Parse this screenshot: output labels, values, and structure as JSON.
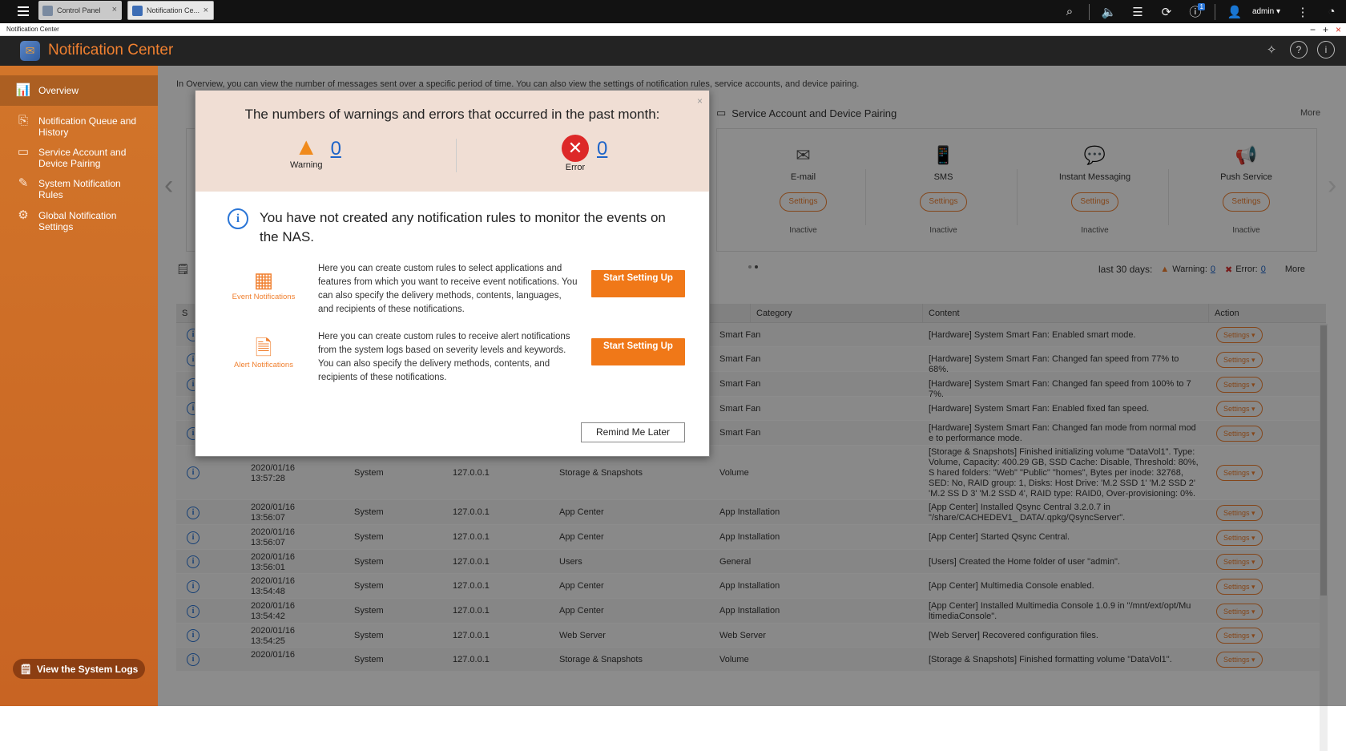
{
  "topbar": {
    "tabs": [
      {
        "label": "Control Panel"
      },
      {
        "label": "Notification Ce..."
      }
    ],
    "user": "admin",
    "notification_badge": "1"
  },
  "window": {
    "title": "Notification Center"
  },
  "app": {
    "title": "Notification Center"
  },
  "sidebar": {
    "items": [
      {
        "label": "Overview",
        "icon": "chart-icon"
      },
      {
        "label": "Notification Queue and History",
        "icon": "history-icon"
      },
      {
        "label": "Service Account and Device Pairing",
        "icon": "device-icon"
      },
      {
        "label": "System Notification Rules",
        "icon": "rules-icon"
      },
      {
        "label": "Global Notification Settings",
        "icon": "settings-icon"
      }
    ],
    "logs_button": "View the System Logs"
  },
  "overview": {
    "intro": "In Overview, you can view the number of messages sent over a specific period of time. You can also view the settings of notification rules, service accounts, and device pairing.",
    "service_section_title": "Service Account and Device Pairing",
    "more": "More",
    "services": [
      {
        "name": "E-mail",
        "button": "Settings",
        "status": "Inactive",
        "icon": "mail-icon"
      },
      {
        "name": "SMS",
        "button": "Settings",
        "status": "Inactive",
        "icon": "sms-icon"
      },
      {
        "name": "Instant Messaging",
        "button": "Settings",
        "status": "Inactive",
        "icon": "chat-icon"
      },
      {
        "name": "Push Service",
        "button": "Settings",
        "status": "Inactive",
        "icon": "megaphone-icon"
      }
    ],
    "stats": {
      "period": "last 30 days:",
      "warning_label": "Warning:",
      "warning_count": "0",
      "error_label": "Error:",
      "error_count": "0",
      "more": "More"
    }
  },
  "table": {
    "columns": [
      "S",
      "",
      "",
      "",
      "",
      "Category",
      "Content",
      "Action"
    ],
    "rows": [
      {
        "date": "",
        "time": "",
        "user": "",
        "ip": "",
        "app": "",
        "category": "Smart Fan",
        "content": "[Hardware] System Smart Fan: Enabled smart mode.",
        "action": "Settings ▾"
      },
      {
        "date": "",
        "time": "",
        "user": "",
        "ip": "",
        "app": "",
        "category": "Smart Fan",
        "content": "[Hardware] System Smart Fan: Changed fan speed from 77% to 68%.",
        "action": "Settings ▾"
      },
      {
        "date": "",
        "time": "",
        "user": "",
        "ip": "",
        "app": "",
        "category": "Smart Fan",
        "content": "[Hardware] System Smart Fan: Changed fan speed from 100% to 7 7%.",
        "action": "Settings ▾"
      },
      {
        "date": "",
        "time": "",
        "user": "",
        "ip": "",
        "app": "",
        "category": "Smart Fan",
        "content": "[Hardware] System Smart Fan: Enabled fixed fan speed.",
        "action": "Settings ▾"
      },
      {
        "date": "",
        "time": "",
        "user": "",
        "ip": "",
        "app": "",
        "category": "Smart Fan",
        "content": "[Hardware] System Smart Fan: Changed fan mode from normal mod e to performance mode.",
        "action": "Settings ▾"
      },
      {
        "date": "2020/01/16",
        "time": "13:57:28",
        "user": "System",
        "ip": "127.0.0.1",
        "app": "Storage & Snapshots",
        "category": "Volume",
        "content": "[Storage & Snapshots] Finished initializing volume \"DataVol1\". Type: Volume, Capacity: 400.29 GB, SSD Cache: Disable, Threshold: 80%, S hared folders: \"Web\" \"Public\" \"homes\", Bytes per inode: 32768, SED: No, RAID group: 1, Disks: Host Drive: 'M.2 SSD 1' 'M.2 SSD 2' 'M.2 SS D 3' 'M.2 SSD 4', RAID type: RAID0, Over-provisioning: 0%.",
        "action": "Settings ▾"
      },
      {
        "date": "2020/01/16",
        "time": "13:56:07",
        "user": "System",
        "ip": "127.0.0.1",
        "app": "App Center",
        "category": "App Installation",
        "content": "[App Center] Installed Qsync Central 3.2.0.7 in \"/share/CACHEDEV1_ DATA/.qpkg/QsyncServer\".",
        "action": "Settings ▾"
      },
      {
        "date": "2020/01/16",
        "time": "13:56:07",
        "user": "System",
        "ip": "127.0.0.1",
        "app": "App Center",
        "category": "App Installation",
        "content": "[App Center] Started Qsync Central.",
        "action": "Settings ▾"
      },
      {
        "date": "2020/01/16",
        "time": "13:56:01",
        "user": "System",
        "ip": "127.0.0.1",
        "app": "Users",
        "category": "General",
        "content": "[Users] Created the Home folder of user \"admin\".",
        "action": "Settings ▾"
      },
      {
        "date": "2020/01/16",
        "time": "13:54:48",
        "user": "System",
        "ip": "127.0.0.1",
        "app": "App Center",
        "category": "App Installation",
        "content": "[App Center] Multimedia Console enabled.",
        "action": "Settings ▾"
      },
      {
        "date": "2020/01/16",
        "time": "13:54:42",
        "user": "System",
        "ip": "127.0.0.1",
        "app": "App Center",
        "category": "App Installation",
        "content": "[App Center] Installed Multimedia Console 1.0.9 in \"/mnt/ext/opt/Mu ltimediaConsole\".",
        "action": "Settings ▾"
      },
      {
        "date": "2020/01/16",
        "time": "13:54:25",
        "user": "System",
        "ip": "127.0.0.1",
        "app": "Web Server",
        "category": "Web Server",
        "content": "[Web Server] Recovered configuration files.",
        "action": "Settings ▾"
      },
      {
        "date": "2020/01/16",
        "time": "",
        "user": "System",
        "ip": "127.0.0.1",
        "app": "Storage & Snapshots",
        "category": "Volume",
        "content": "[Storage & Snapshots] Finished formatting volume \"DataVol1\".",
        "action": "Settings ▾"
      }
    ]
  },
  "modal": {
    "title": "The numbers of warnings and errors that occurred in the past month:",
    "warning_label": "Warning",
    "warning_count": "0",
    "error_label": "Error",
    "error_count": "0",
    "info": "You have not created any notification rules to monitor the events on the NAS.",
    "event": {
      "label": "Event Notifications",
      "text": "Here you can create custom rules to select applications and features from which you want to receive event notifications. You can also specify the delivery methods, contents, languages, and recipients of these notifications.",
      "button": "Start Setting Up"
    },
    "alert": {
      "label": "Alert Notifications",
      "text": "Here you can create custom rules to receive alert notifications from the system logs based on severity levels and keywords. You can also specify the delivery methods, contents, and recipients of these notifications.",
      "button": "Start Setting Up"
    },
    "remind": "Remind Me Later"
  }
}
